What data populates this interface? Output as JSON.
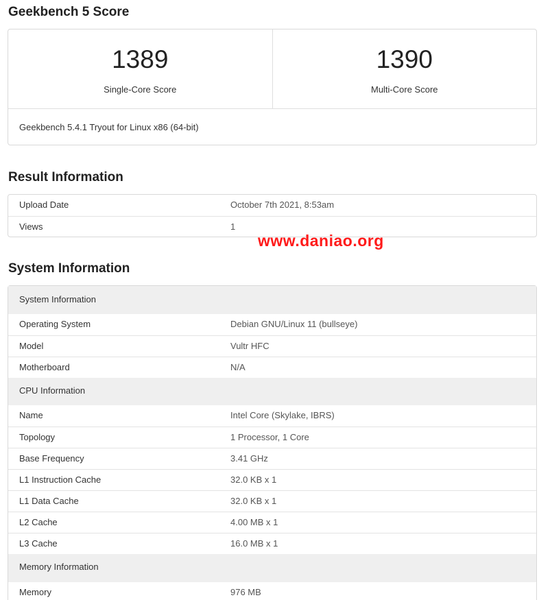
{
  "score_section": {
    "title": "Geekbench 5 Score",
    "single_core": {
      "value": "1389",
      "label": "Single-Core Score"
    },
    "multi_core": {
      "value": "1390",
      "label": "Multi-Core Score"
    },
    "version": "Geekbench 5.4.1 Tryout for Linux x86 (64-bit)"
  },
  "result_section": {
    "title": "Result Information",
    "rows": [
      {
        "key": "Upload Date",
        "value": "October 7th 2021, 8:53am"
      },
      {
        "key": "Views",
        "value": "1"
      }
    ]
  },
  "watermark": "www.daniao.org",
  "system_section": {
    "title": "System Information",
    "groups": [
      {
        "header": "System Information",
        "rows": [
          {
            "key": "Operating System",
            "value": "Debian GNU/Linux 11 (bullseye)"
          },
          {
            "key": "Model",
            "value": "Vultr HFC"
          },
          {
            "key": "Motherboard",
            "value": "N/A"
          }
        ]
      },
      {
        "header": "CPU Information",
        "rows": [
          {
            "key": "Name",
            "value": "Intel Core (Skylake, IBRS)"
          },
          {
            "key": "Topology",
            "value": "1 Processor, 1 Core"
          },
          {
            "key": "Base Frequency",
            "value": "3.41 GHz"
          },
          {
            "key": "L1 Instruction Cache",
            "value": "32.0 KB x 1"
          },
          {
            "key": "L1 Data Cache",
            "value": "32.0 KB x 1"
          },
          {
            "key": "L2 Cache",
            "value": "4.00 MB x 1"
          },
          {
            "key": "L3 Cache",
            "value": "16.0 MB x 1"
          }
        ]
      },
      {
        "header": "Memory Information",
        "rows": [
          {
            "key": "Memory",
            "value": "976 MB"
          }
        ]
      }
    ]
  }
}
